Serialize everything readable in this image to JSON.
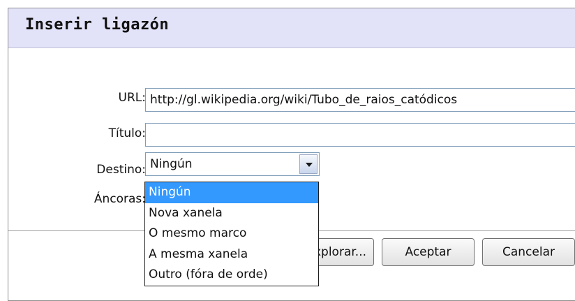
{
  "dialog": {
    "title": "Inserir ligazón"
  },
  "form": {
    "url_label": "URL:",
    "url_value": "http://gl.wikipedia.org/wiki/Tubo_de_raios_catódicos",
    "titulo_label": "Título:",
    "titulo_value": "",
    "destino_label": "Destino:",
    "destino_value": "Ningún",
    "ancoras_label": "Áncoras:"
  },
  "dropdown": {
    "options": [
      {
        "label": "Ningún",
        "selected": true
      },
      {
        "label": "Nova xanela",
        "selected": false
      },
      {
        "label": "O mesmo marco",
        "selected": false
      },
      {
        "label": "A mesma xanela",
        "selected": false
      },
      {
        "label": "Outro (fóra de orde)",
        "selected": false
      }
    ]
  },
  "buttons": {
    "browse_label": "Explorar...",
    "accept_label": "Aceptar",
    "cancel_label": "Cancelar"
  },
  "icons": {
    "select_arrow": "chevron-down-icon"
  },
  "colors": {
    "titlebar_bg": "#e2e2f8",
    "selection": "#3399ff",
    "field_border": "#7f9db9"
  }
}
